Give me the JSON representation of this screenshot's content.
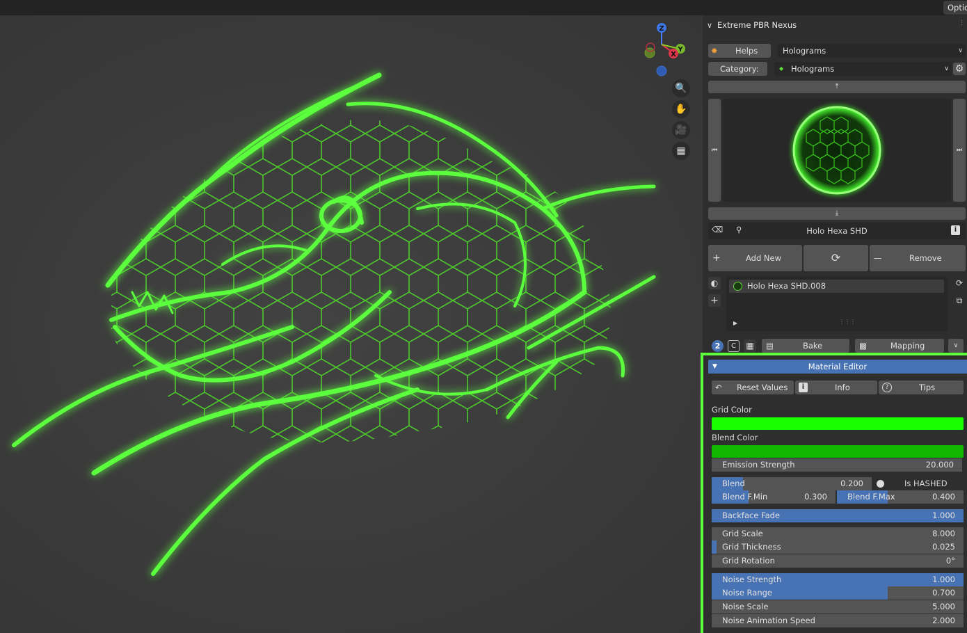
{
  "topbar": {
    "options_label": "Options"
  },
  "panel": {
    "title": "Extreme PBR Nexus",
    "helps_label": "Helps",
    "helps_dropdown": "Holograms",
    "category_label": "Category:",
    "category_value": "Holograms",
    "search_name": "Holo Hexa SHD",
    "add_new_label": "Add New",
    "remove_label": "Remove",
    "material_slot": "Holo Hexa SHD.008",
    "bake_label": "Bake",
    "mapping_label": "Mapping",
    "badge_number": "2",
    "badge_letter": "C"
  },
  "material_editor": {
    "title": "Material Editor",
    "reset_label": "Reset Values",
    "info_label": "Info",
    "tips_label": "Tips",
    "grid_color_label": "Grid Color",
    "grid_color": "#18ff00",
    "blend_color_label": "Blend Color",
    "blend_color": "#10b800",
    "emission_label": "Emission Strength",
    "emission_value": "20.000",
    "blend_label": "Blend",
    "blend_value": "0.200",
    "is_hashed_label": "Is HASHED",
    "blend_fmin_label": "Blend F.Min",
    "blend_fmin_value": "0.300",
    "blend_fmax_label": "Blend F.Max",
    "blend_fmax_value": "0.400",
    "backface_label": "Backface Fade",
    "backface_value": "1.000",
    "grid_scale_label": "Grid Scale",
    "grid_scale_value": "8.000",
    "grid_thickness_label": "Grid Thickness",
    "grid_thickness_value": "0.025",
    "grid_rotation_label": "Grid Rotation",
    "grid_rotation_value": "0°",
    "noise_strength_label": "Noise Strength",
    "noise_strength_value": "1.000",
    "noise_range_label": "Noise Range",
    "noise_range_value": "0.700",
    "noise_scale_label": "Noise Scale",
    "noise_scale_value": "5.000",
    "noise_anim_label": "Noise Animation Speed",
    "noise_anim_value": "2.000"
  },
  "gizmo": {
    "z": "Z",
    "y": "Y",
    "x": "X"
  },
  "colors": {
    "accent": "#4772b3",
    "glow": "#5cff3c",
    "panel_bg": "#2e2e2e"
  }
}
